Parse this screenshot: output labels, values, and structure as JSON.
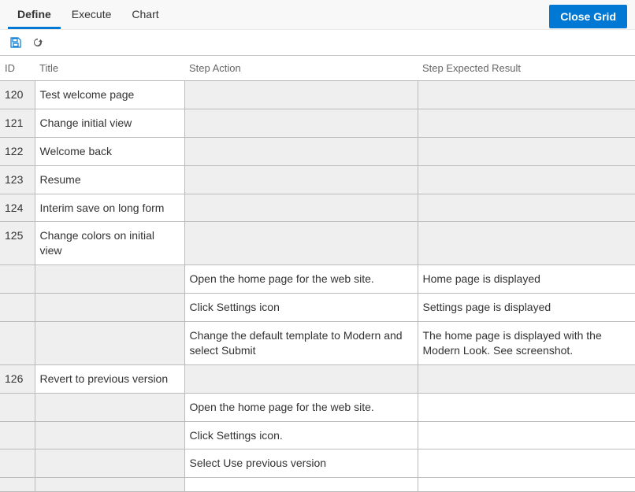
{
  "tabs": {
    "define": "Define",
    "execute": "Execute",
    "chart": "Chart"
  },
  "close_label": "Close Grid",
  "columns": {
    "id": "ID",
    "title": "Title",
    "action": "Step Action",
    "result": "Step Expected Result"
  },
  "rows": [
    {
      "id": "120",
      "title": "Test welcome page",
      "action": "",
      "result": "",
      "shadeAction": true,
      "shadeResult": true
    },
    {
      "id": "121",
      "title": "Change initial view",
      "action": "",
      "result": "",
      "shadeAction": true,
      "shadeResult": true
    },
    {
      "id": "122",
      "title": "Welcome back",
      "action": "",
      "result": "",
      "shadeAction": true,
      "shadeResult": true
    },
    {
      "id": "123",
      "title": "Resume",
      "action": "",
      "result": "",
      "shadeAction": true,
      "shadeResult": true
    },
    {
      "id": "124",
      "title": "Interim save on long form",
      "action": "",
      "result": "",
      "shadeAction": true,
      "shadeResult": true
    },
    {
      "id": "125",
      "title": "Change colors on initial view",
      "action": "",
      "result": "",
      "shadeAction": true,
      "shadeResult": true
    },
    {
      "id": "",
      "title": "",
      "action": "Open the home page for the web site.",
      "result": "Home page is displayed",
      "shadeId": true,
      "shadeTitle": true
    },
    {
      "id": "",
      "title": "",
      "action": "Click Settings icon",
      "result": "Settings page is displayed",
      "shadeId": true,
      "shadeTitle": true
    },
    {
      "id": "",
      "title": "",
      "action": "Change the default template to Modern and select Submit",
      "result": "The home page is displayed with the Modern Look. See screenshot.",
      "shadeId": true,
      "shadeTitle": true
    },
    {
      "id": "126",
      "title": "Revert to previous version",
      "action": "",
      "result": "",
      "shadeAction": true,
      "shadeResult": true
    },
    {
      "id": "",
      "title": "",
      "action": "Open the home page for the web site.",
      "result": "",
      "shadeId": true,
      "shadeTitle": true
    },
    {
      "id": "",
      "title": "",
      "action": "Click Settings icon.",
      "result": "",
      "shadeId": true,
      "shadeTitle": true
    },
    {
      "id": "",
      "title": "",
      "action": "Select Use previous version",
      "result": "",
      "shadeId": true,
      "shadeTitle": true
    },
    {
      "id": "",
      "title": "",
      "action": "",
      "result": "",
      "shadeId": true,
      "shadeTitle": true,
      "small": true
    }
  ]
}
